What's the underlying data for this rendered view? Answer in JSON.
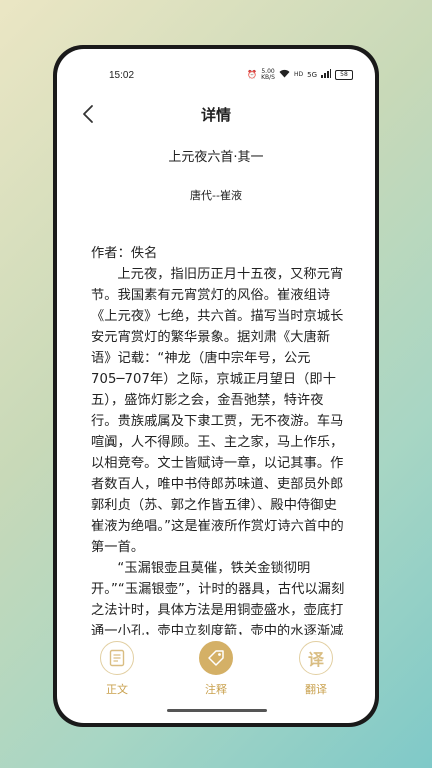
{
  "status": {
    "time": "15:02",
    "net_speed_value": "5.00",
    "net_speed_unit": "KB/S",
    "network": "5G",
    "battery": "58"
  },
  "header": {
    "title": "详情"
  },
  "poem": {
    "title": "上元夜六首·其一",
    "dynasty_author": "唐代--崔液"
  },
  "annotation": {
    "author_line": "作者：佚名",
    "paragraph1": "上元夜，指旧历正月十五夜，又称元宵节。我国素有元宵赏灯的风俗。崔液组诗《上元夜》七绝，共六首。描写当时京城长安元宵赏灯的繁华景象。据刘肃《大唐新语》记载：“神龙（唐中宗年号，公元705─707年）之际，京城正月望日（即十五），盛饰灯影之会，金吾弛禁，特许夜行。贵族戚属及下隶工贾，无不夜游。车马喧阗，人不得顾。王、主之家，马上作乐，以相竞夸。文士皆赋诗一章，以记其事。作者数百人，唯中书侍郎苏味道、吏部员外郎郭利贞（苏、郭之作皆五律）、殿中侍御史崔液为绝唱。”这是崔液所作赏灯诗六首中的第一首。",
    "paragraph2": "“玉漏银壶且莫催，铁关金锁彻明开。”“玉漏银壶”，计时的器具，古代以漏刻之法计时，具体方法是用铜壶盛水，壶底打通一小孔，壶中立刻度箭，壶中的水逐渐减少，箭上的度数就依次显露，就可按度计时，走鼓报更。三宵"
  },
  "tabs": [
    {
      "label": "正文",
      "icon": "document-icon"
    },
    {
      "label": "注释",
      "icon": "tag-icon"
    },
    {
      "label": "翻译",
      "icon": "translate-icon",
      "glyph": "译"
    }
  ],
  "colors": {
    "accent": "#d4b066",
    "accent_text": "#c9a14e",
    "accent_light": "#e2cfa2"
  }
}
